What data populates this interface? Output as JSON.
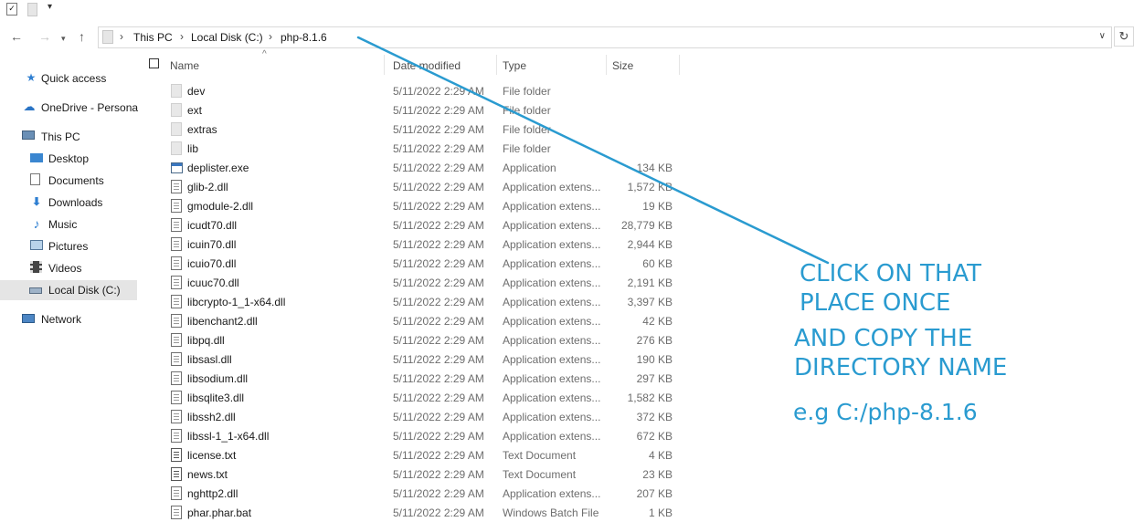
{
  "address_bar": {
    "crumbs": [
      "This PC",
      "Local Disk (C:)",
      "php-8.1.6"
    ]
  },
  "sidebar": {
    "items": [
      {
        "label": "Quick access",
        "icon": "star-icon"
      },
      {
        "label": "OneDrive - Persona",
        "icon": "cloud-icon"
      },
      {
        "label": "This PC",
        "icon": "computer-icon"
      },
      {
        "label": "Desktop",
        "icon": "desktop-icon"
      },
      {
        "label": "Documents",
        "icon": "documents-icon"
      },
      {
        "label": "Downloads",
        "icon": "download-icon"
      },
      {
        "label": "Music",
        "icon": "music-icon"
      },
      {
        "label": "Pictures",
        "icon": "pictures-icon"
      },
      {
        "label": "Videos",
        "icon": "videos-icon"
      },
      {
        "label": "Local Disk (C:)",
        "icon": "drive-icon",
        "selected": true
      },
      {
        "label": "Network",
        "icon": "network-icon"
      }
    ]
  },
  "columns": {
    "name": "Name",
    "date": "Date modified",
    "type": "Type",
    "size": "Size"
  },
  "files": [
    {
      "name": "dev",
      "date": "5/11/2022 2:29 AM",
      "type": "File folder",
      "size": "",
      "icon": "folder"
    },
    {
      "name": "ext",
      "date": "5/11/2022 2:29 AM",
      "type": "File folder",
      "size": "",
      "icon": "folder"
    },
    {
      "name": "extras",
      "date": "5/11/2022 2:29 AM",
      "type": "File folder",
      "size": "",
      "icon": "folder"
    },
    {
      "name": "lib",
      "date": "5/11/2022 2:29 AM",
      "type": "File folder",
      "size": "",
      "icon": "folder"
    },
    {
      "name": "deplister.exe",
      "date": "5/11/2022 2:29 AM",
      "type": "Application",
      "size": "134 KB",
      "icon": "exe"
    },
    {
      "name": "glib-2.dll",
      "date": "5/11/2022 2:29 AM",
      "type": "Application extens...",
      "size": "1,572 KB",
      "icon": "file"
    },
    {
      "name": "gmodule-2.dll",
      "date": "5/11/2022 2:29 AM",
      "type": "Application extens...",
      "size": "19 KB",
      "icon": "file"
    },
    {
      "name": "icudt70.dll",
      "date": "5/11/2022 2:29 AM",
      "type": "Application extens...",
      "size": "28,779 KB",
      "icon": "file"
    },
    {
      "name": "icuin70.dll",
      "date": "5/11/2022 2:29 AM",
      "type": "Application extens...",
      "size": "2,944 KB",
      "icon": "file"
    },
    {
      "name": "icuio70.dll",
      "date": "5/11/2022 2:29 AM",
      "type": "Application extens...",
      "size": "60 KB",
      "icon": "file"
    },
    {
      "name": "icuuc70.dll",
      "date": "5/11/2022 2:29 AM",
      "type": "Application extens...",
      "size": "2,191 KB",
      "icon": "file"
    },
    {
      "name": "libcrypto-1_1-x64.dll",
      "date": "5/11/2022 2:29 AM",
      "type": "Application extens...",
      "size": "3,397 KB",
      "icon": "file"
    },
    {
      "name": "libenchant2.dll",
      "date": "5/11/2022 2:29 AM",
      "type": "Application extens...",
      "size": "42 KB",
      "icon": "file"
    },
    {
      "name": "libpq.dll",
      "date": "5/11/2022 2:29 AM",
      "type": "Application extens...",
      "size": "276 KB",
      "icon": "file"
    },
    {
      "name": "libsasl.dll",
      "date": "5/11/2022 2:29 AM",
      "type": "Application extens...",
      "size": "190 KB",
      "icon": "file"
    },
    {
      "name": "libsodium.dll",
      "date": "5/11/2022 2:29 AM",
      "type": "Application extens...",
      "size": "297 KB",
      "icon": "file"
    },
    {
      "name": "libsqlite3.dll",
      "date": "5/11/2022 2:29 AM",
      "type": "Application extens...",
      "size": "1,582 KB",
      "icon": "file"
    },
    {
      "name": "libssh2.dll",
      "date": "5/11/2022 2:29 AM",
      "type": "Application extens...",
      "size": "372 KB",
      "icon": "file"
    },
    {
      "name": "libssl-1_1-x64.dll",
      "date": "5/11/2022 2:29 AM",
      "type": "Application extens...",
      "size": "672 KB",
      "icon": "file"
    },
    {
      "name": "license.txt",
      "date": "5/11/2022 2:29 AM",
      "type": "Text Document",
      "size": "4 KB",
      "icon": "txt"
    },
    {
      "name": "news.txt",
      "date": "5/11/2022 2:29 AM",
      "type": "Text Document",
      "size": "23 KB",
      "icon": "txt"
    },
    {
      "name": "nghttp2.dll",
      "date": "5/11/2022 2:29 AM",
      "type": "Application extens...",
      "size": "207 KB",
      "icon": "file"
    },
    {
      "name": "phar.phar.bat",
      "date": "5/11/2022 2:29 AM",
      "type": "Windows Batch File",
      "size": "1 KB",
      "icon": "file"
    }
  ],
  "annotation": {
    "lines": [
      "CLICK ON THAT",
      "PLACE ONCE",
      "AND COPY THE",
      "DIRECTORY NAME",
      "e.g C:/php-8.1.6"
    ],
    "color": "#2a9bd0"
  }
}
